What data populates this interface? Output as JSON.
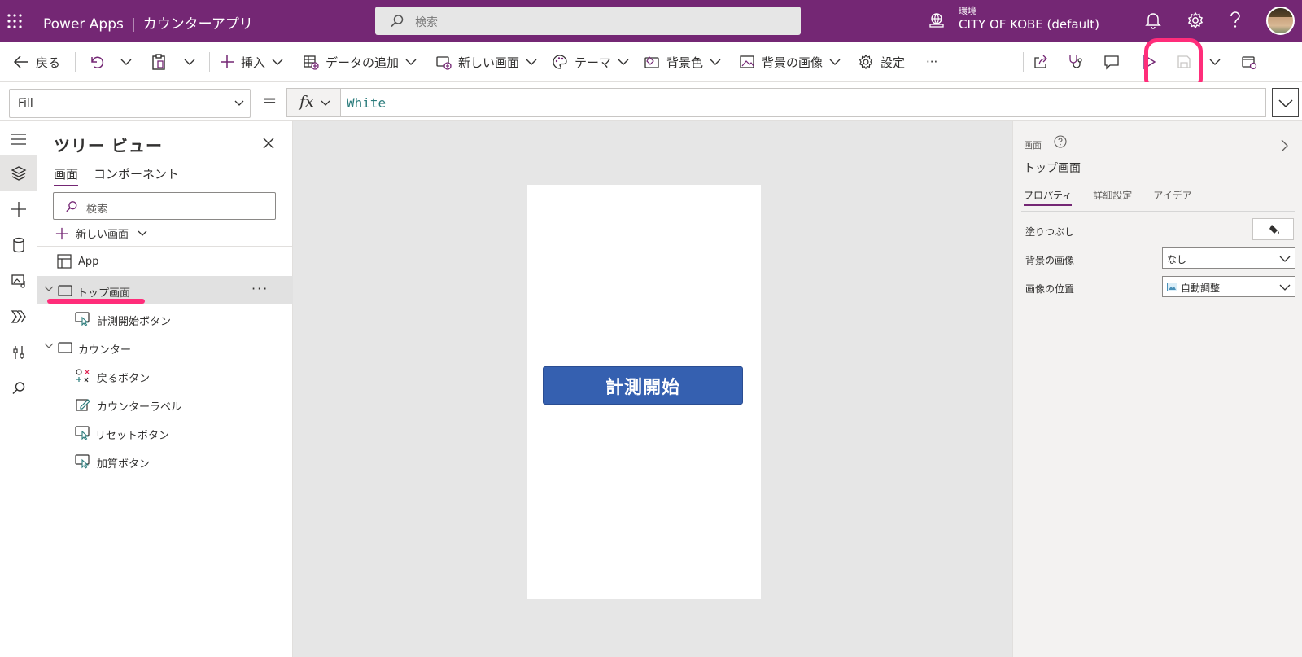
{
  "topbar": {
    "app_brand": "Power Apps",
    "separator": "|",
    "app_title": "カウンターアプリ",
    "search_placeholder": "検索",
    "environment_label": "環境",
    "environment_name": "CITY OF KOBE (default)",
    "icons": [
      "waffle-icon",
      "search-icon",
      "environment-icon",
      "bell-icon",
      "gear-icon",
      "help-icon",
      "avatar"
    ],
    "brand_color": "#742774"
  },
  "commandbar": {
    "back": "戻る",
    "insert": "挿入",
    "add_data": "データの追加",
    "new_screen": "新しい画面",
    "theme": "テーマ",
    "background_color": "背景色",
    "background_image": "背景の画像",
    "settings": "設定",
    "more": "···",
    "highlight_color": "#ff2d7a"
  },
  "formula": {
    "property": "Fill",
    "equals": "=",
    "fx": "fx",
    "value": "White"
  },
  "tree": {
    "title": "ツリー ビュー",
    "tabs": [
      "画面",
      "コンポーネント"
    ],
    "search_placeholder": "検索",
    "new_screen": "新しい画面",
    "items": [
      {
        "label": "App",
        "icon": "app-icon"
      },
      {
        "label": "トップ画面",
        "icon": "screen-icon",
        "selected": true,
        "more": "···"
      },
      {
        "label": "計測開始ボタン",
        "icon": "button-icon"
      },
      {
        "label": "カウンター",
        "icon": "screen-icon"
      },
      {
        "label": "戻るボタン",
        "icon": "icon-control-icon"
      },
      {
        "label": "カウンターラベル",
        "icon": "label-icon"
      },
      {
        "label": "リセットボタン",
        "icon": "button-icon"
      },
      {
        "label": "加算ボタン",
        "icon": "button-icon"
      }
    ]
  },
  "canvas": {
    "button_label": "計測開始",
    "button_color": "#3560b0"
  },
  "properties": {
    "type": "画面",
    "name": "トップ画面",
    "tabs": [
      "プロパティ",
      "詳細設定",
      "アイデア"
    ],
    "fill_label": "塗りつぶし",
    "bg_image_label": "背景の画像",
    "bg_image_value": "なし",
    "image_position_label": "画像の位置",
    "image_position_value": "自動調整"
  }
}
